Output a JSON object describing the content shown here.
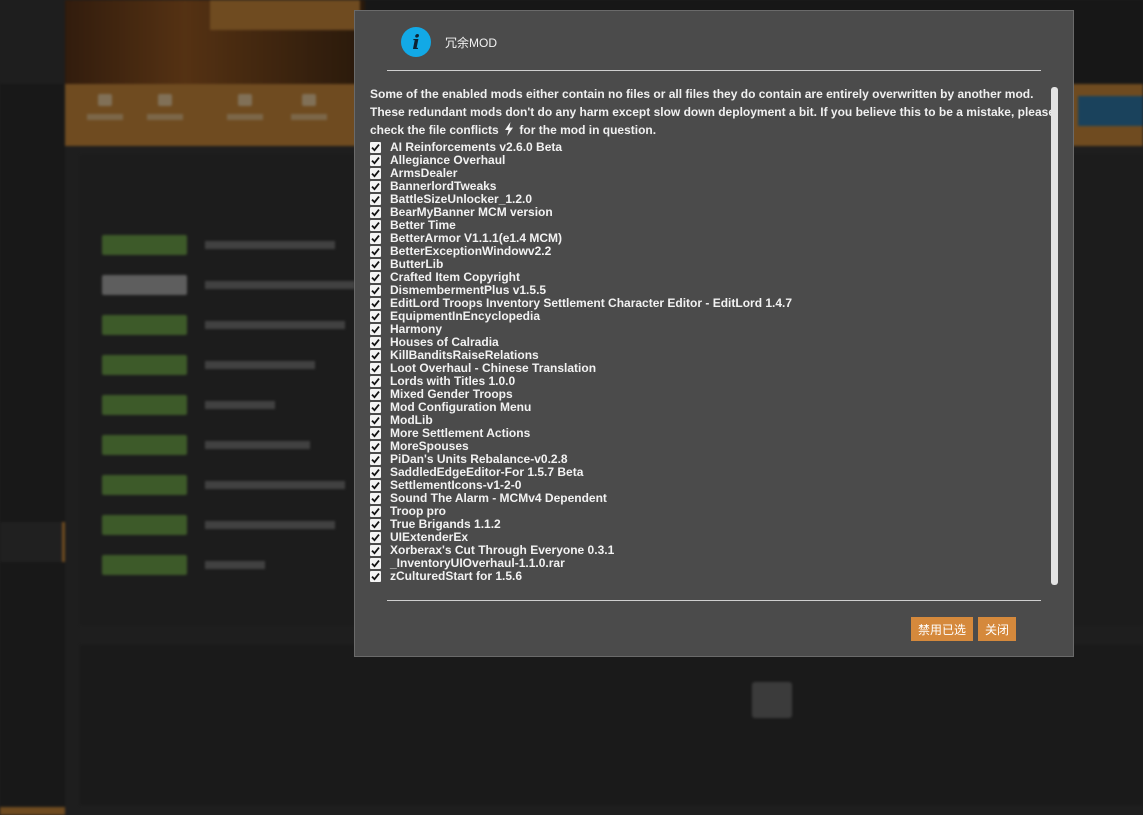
{
  "dialog": {
    "title": "冗余MOD",
    "message_part1": "Some of the enabled mods either contain no files or all files they do contain are entirely overwritten by another mod. These redundant mods don't do any harm except slow down deployment a bit. If you believe this to be a mistake, please check the file conflicts",
    "message_part2": "for the mod in question.",
    "mods": [
      {
        "label": "AI Reinforcements v2.6.0 Beta",
        "checked": true
      },
      {
        "label": "Allegiance Overhaul",
        "checked": true
      },
      {
        "label": "ArmsDealer",
        "checked": true
      },
      {
        "label": "BannerlordTweaks",
        "checked": true
      },
      {
        "label": "BattleSizeUnlocker_1.2.0",
        "checked": true
      },
      {
        "label": "BearMyBanner MCM version",
        "checked": true
      },
      {
        "label": "Better Time",
        "checked": true
      },
      {
        "label": "BetterArmor V1.1.1(e1.4 MCM)",
        "checked": true
      },
      {
        "label": "BetterExceptionWindowv2.2",
        "checked": true
      },
      {
        "label": "ButterLib",
        "checked": true
      },
      {
        "label": "Crafted Item Copyright",
        "checked": true
      },
      {
        "label": "DismembermentPlus v1.5.5",
        "checked": true
      },
      {
        "label": "EditLord Troops Inventory Settlement Character Editor - EditLord 1.4.7",
        "checked": true
      },
      {
        "label": "EquipmentInEncyclopedia",
        "checked": true
      },
      {
        "label": "Harmony",
        "checked": true
      },
      {
        "label": "Houses of Calradia",
        "checked": true
      },
      {
        "label": "KillBanditsRaiseRelations",
        "checked": true
      },
      {
        "label": "Loot Overhaul - Chinese Translation",
        "checked": true
      },
      {
        "label": "Lords with Titles 1.0.0",
        "checked": true
      },
      {
        "label": "Mixed Gender Troops",
        "checked": true
      },
      {
        "label": "Mod Configuration Menu",
        "checked": true
      },
      {
        "label": "ModLib",
        "checked": true
      },
      {
        "label": "More Settlement Actions",
        "checked": true
      },
      {
        "label": "MoreSpouses",
        "checked": true
      },
      {
        "label": "PiDan's Units Rebalance-v0.2.8",
        "checked": true
      },
      {
        "label": "SaddledEdgeEditor-For 1.5.7 Beta",
        "checked": true
      },
      {
        "label": "SettlementIcons-v1-2-0",
        "checked": true
      },
      {
        "label": "Sound The Alarm - MCMv4 Dependent",
        "checked": true
      },
      {
        "label": "Troop pro",
        "checked": true
      },
      {
        "label": "True Brigands 1.1.2",
        "checked": true
      },
      {
        "label": "UIExtenderEx",
        "checked": true
      },
      {
        "label": "Xorberax's Cut Through Everyone 0.3.1",
        "checked": true
      },
      {
        "label": "_InventoryUIOverhaul-1.1.0.rar",
        "checked": true
      },
      {
        "label": "zCulturedStart for 1.5.6",
        "checked": true
      }
    ],
    "buttons": {
      "disable_selected": "禁用已选",
      "close": "关闭"
    }
  },
  "colors": {
    "accent": "#d5893c",
    "info_icon": "#12a9e6",
    "dialog_bg": "#4b4b4b"
  },
  "icons": {
    "header": "info-icon",
    "conflict": "lightning-bolt-icon",
    "checkbox": "checkmark-icon"
  }
}
